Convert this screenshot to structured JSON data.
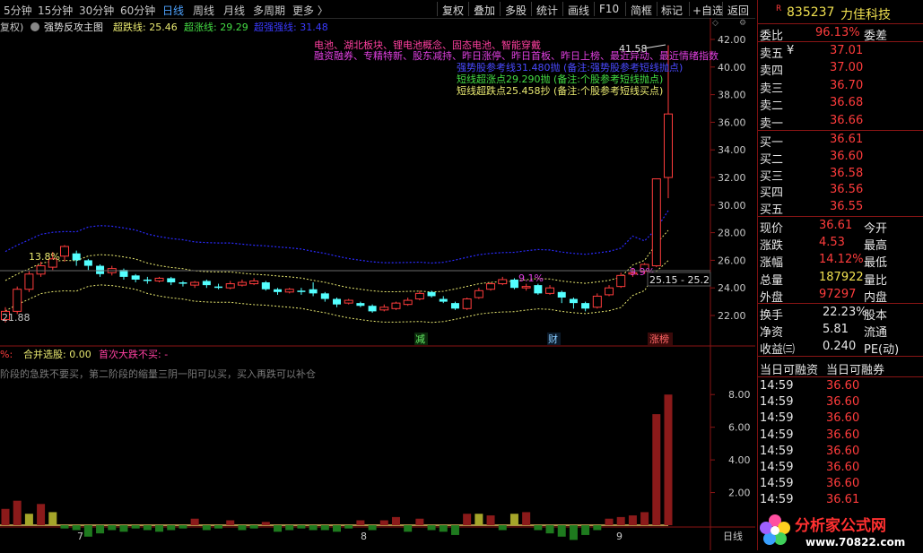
{
  "toolbar": {
    "periods": [
      "5分钟",
      "15分钟",
      "30分钟",
      "60分钟",
      "日线",
      "周线",
      "月线",
      "多周期",
      "更多 〉"
    ],
    "active_period": "日线",
    "buttons": [
      "复权",
      "叠加",
      "多股",
      "统计",
      "画线",
      "F10",
      "简框",
      "标记",
      "+自选",
      "返回"
    ]
  },
  "indicator_header": {
    "fuquan": "复权)",
    "name": "强势反攻主图",
    "chaodie_label": "超跌线: 25.46",
    "chaozhang_label": "超涨线: 29.29",
    "qiangshi_label": "超强强线: 31.48"
  },
  "colors": {
    "up": "#ff3c3c",
    "down": "#54ffff",
    "blue_band": "#2a2aff",
    "yellow_band": "#e8e870",
    "accent_blue": "#4ea3ff",
    "vol_red": "#8b1a1a",
    "vol_green": "#1e7a1e",
    "vol_olive": "#a5a52a"
  },
  "notes": {
    "tags_line1": "电池、湖北板块、锂电池概念、固态电池、智能穿戴",
    "tags_line2": "融资融券、专精特新、股东减持、昨日涨停、昨日首板、昨日上榜、最近异动、最近情绪指数",
    "signal1": "强势股参考线31.480抛 (备注:强势股参考短线抛点)",
    "signal2": "短线超涨点29.290抛 (备注:个股参考短线抛点)",
    "signal3": "短线超跌点25.458抄 (备注:个股参考短线买点)"
  },
  "chart_labels": {
    "high_pct": "13.8%",
    "mid_pct": "9.1%",
    "last_pct": "9.9%",
    "low_price": "21.88",
    "peak_price": "41.58",
    "crosshair_text": "25.15 - 25.2",
    "mark_jian": "减",
    "mark_cai": "财",
    "mark_zhangbang": "涨榜"
  },
  "price_axis": [
    "42.00",
    "40.00",
    "38.00",
    "36.00",
    "34.00",
    "32.00",
    "30.00",
    "28.00",
    "26.00",
    "24.00",
    "22.00"
  ],
  "lower_header": {
    "pct": "%:",
    "hebing": "合并选股: 0.00",
    "shouci": "首次大跌不买: -"
  },
  "lower_note": "阶段的急跌不要买，第二阶段的缩量三阴一阳可以买，买入再跌可以补仓",
  "lower_axis": [
    "8.00",
    "6.00",
    "4.00",
    "2.00"
  ],
  "date_ticks": [
    "7",
    "8",
    "9"
  ],
  "axis_bottom_label": "日线",
  "chart_data": {
    "type": "candlestick",
    "candles": [
      [
        21.7,
        22.3,
        22.6,
        21.5
      ],
      [
        22.3,
        23.9,
        24.1,
        22.1
      ],
      [
        23.9,
        25.0,
        25.2,
        23.7
      ],
      [
        25.0,
        25.6,
        25.9,
        24.8
      ],
      [
        25.5,
        26.1,
        26.6,
        25.3
      ],
      [
        26.3,
        27.0,
        27.1,
        25.9
      ],
      [
        26.5,
        26.0,
        26.7,
        25.6
      ],
      [
        26.0,
        25.6,
        26.1,
        25.3
      ],
      [
        25.6,
        25.0,
        25.7,
        24.8
      ],
      [
        25.1,
        25.4,
        25.6,
        24.9
      ],
      [
        25.3,
        24.8,
        25.4,
        24.6
      ],
      [
        24.9,
        24.6,
        25.0,
        24.4
      ],
      [
        24.6,
        24.5,
        24.8,
        24.3
      ],
      [
        24.5,
        24.7,
        24.8,
        24.4
      ],
      [
        24.7,
        24.4,
        24.8,
        24.2
      ],
      [
        24.4,
        24.3,
        24.5,
        24.1
      ],
      [
        24.2,
        24.4,
        24.5,
        24.0
      ],
      [
        24.5,
        24.2,
        24.6,
        24.0
      ],
      [
        24.1,
        24.0,
        24.3,
        23.9
      ],
      [
        24.0,
        24.3,
        24.5,
        23.9
      ],
      [
        24.2,
        24.4,
        24.6,
        24.1
      ],
      [
        24.3,
        24.5,
        24.7,
        24.2
      ],
      [
        24.4,
        23.9,
        24.5,
        23.8
      ],
      [
        23.9,
        23.7,
        24.0,
        23.5
      ],
      [
        23.7,
        23.9,
        24.0,
        23.6
      ],
      [
        23.8,
        23.7,
        24.0,
        23.5
      ],
      [
        23.9,
        23.6,
        24.4,
        23.4
      ],
      [
        23.6,
        23.2,
        23.7,
        23.0
      ],
      [
        23.2,
        22.8,
        23.3,
        22.6
      ],
      [
        22.9,
        23.1,
        23.2,
        22.8
      ],
      [
        22.9,
        22.7,
        23.0,
        22.6
      ],
      [
        22.7,
        22.3,
        22.8,
        22.2
      ],
      [
        22.4,
        22.6,
        22.8,
        22.3
      ],
      [
        22.5,
        22.9,
        23.0,
        22.4
      ],
      [
        22.8,
        23.1,
        23.3,
        22.7
      ],
      [
        23.2,
        23.6,
        23.8,
        23.1
      ],
      [
        23.7,
        23.4,
        23.8,
        23.3
      ],
      [
        23.2,
        23.0,
        23.4,
        22.9
      ],
      [
        22.9,
        22.5,
        23.0,
        22.4
      ],
      [
        22.5,
        23.2,
        23.3,
        22.4
      ],
      [
        23.3,
        23.8,
        24.0,
        23.2
      ],
      [
        23.9,
        24.3,
        24.4,
        23.8
      ],
      [
        24.3,
        24.6,
        24.8,
        24.2
      ],
      [
        24.6,
        24.0,
        24.7,
        23.9
      ],
      [
        24.0,
        24.1,
        24.3,
        23.8
      ],
      [
        24.2,
        23.6,
        24.3,
        23.5
      ],
      [
        23.6,
        24.0,
        24.2,
        23.5
      ],
      [
        23.7,
        23.3,
        23.8,
        22.9
      ],
      [
        23.2,
        22.9,
        23.3,
        22.5
      ],
      [
        22.9,
        22.5,
        23.0,
        22.3
      ],
      [
        22.6,
        23.4,
        23.6,
        22.5
      ],
      [
        23.5,
        24.0,
        24.2,
        23.4
      ],
      [
        24.1,
        24.9,
        25.1,
        24.0
      ],
      [
        25.0,
        25.1,
        25.4,
        24.8
      ],
      [
        25.2,
        25.7,
        25.8,
        25.0
      ],
      [
        25.6,
        31.9,
        31.9,
        25.5
      ],
      [
        32.0,
        36.6,
        41.58,
        30.5
      ]
    ],
    "volumes": [
      1.0,
      1.5,
      0.7,
      1.3,
      0.8,
      -0.2,
      -0.3,
      -0.7,
      -0.5,
      -0.3,
      -0.4,
      -0.2,
      -0.3,
      -0.4,
      -0.3,
      -0.2,
      0.4,
      -0.3,
      -0.2,
      0.3,
      -0.3,
      -0.2,
      0.2,
      -0.4,
      -0.3,
      -0.2,
      -0.3,
      -0.3,
      -0.4,
      -0.2,
      0.3,
      -0.3,
      0.3,
      0.5,
      -0.4,
      0.4,
      -0.3,
      -0.4,
      -0.6,
      0.7,
      0.7,
      0.6,
      -0.3,
      0.7,
      0.8,
      -0.3,
      -0.5,
      -0.7,
      -0.9,
      -0.6,
      -0.3,
      0.4,
      0.5,
      0.6,
      0.8,
      6.8,
      8.0
    ],
    "bands_note": "upper blue dotted, middle and lower yellow dotted envelopes",
    "ylim": [
      21.2,
      43.0
    ],
    "vol_ylim": [
      0,
      9.0
    ]
  },
  "right_panel": {
    "code_badge": "R",
    "code": "835237",
    "name": "力佳科技",
    "weibi_label": "委比",
    "weibi": "96.13%",
    "weicha_label": "委差",
    "asks": [
      {
        "label": "卖五",
        "flag": "¥",
        "price": "37.01"
      },
      {
        "label": "卖四",
        "flag": "",
        "price": "37.00"
      },
      {
        "label": "卖三",
        "flag": "",
        "price": "36.70"
      },
      {
        "label": "卖二",
        "flag": "",
        "price": "36.68"
      },
      {
        "label": "卖一",
        "flag": "",
        "price": "36.66"
      }
    ],
    "bids": [
      {
        "label": "买一",
        "price": "36.61"
      },
      {
        "label": "买二",
        "price": "36.60"
      },
      {
        "label": "买三",
        "price": "36.58"
      },
      {
        "label": "买四",
        "price": "36.56"
      },
      {
        "label": "买五",
        "price": "36.55"
      }
    ],
    "stats": [
      {
        "l1": "现价",
        "v1": "36.61",
        "l2": "今开",
        "c1": "red"
      },
      {
        "l1": "涨跌",
        "v1": "4.53",
        "l2": "最高",
        "c1": "red"
      },
      {
        "l1": "涨幅",
        "v1": "14.12%",
        "l2": "最低",
        "c1": "red"
      },
      {
        "l1": "总量",
        "v1": "187922",
        "l2": "量比",
        "c1": "yel"
      },
      {
        "l1": "外盘",
        "v1": "97297",
        "l2": "内盘",
        "c1": "red"
      }
    ],
    "stats2": [
      {
        "l1": "换手",
        "v1": "22.23%",
        "l2": "股本",
        "c1": "wht"
      },
      {
        "l1": "净资",
        "v1": "5.81",
        "l2": "流通",
        "c1": "wht"
      },
      {
        "l1": "收益㈢",
        "v1": "0.240",
        "l2": "PE(动)",
        "c1": "wht"
      }
    ],
    "margin_header1": "当日可融资",
    "margin_header2": "当日可融券",
    "ticks": [
      {
        "t": "14:59",
        "p": "36.60"
      },
      {
        "t": "14:59",
        "p": "36.60"
      },
      {
        "t": "14:59",
        "p": "36.60"
      },
      {
        "t": "14:59",
        "p": "36.60"
      },
      {
        "t": "14:59",
        "p": "36.60"
      },
      {
        "t": "14:59",
        "p": "36.60"
      },
      {
        "t": "14:59",
        "p": "36.60"
      },
      {
        "t": "14:59",
        "p": "36.61"
      }
    ],
    "logo_text": "分析家公式网",
    "logo_url": "www.70822.com"
  }
}
